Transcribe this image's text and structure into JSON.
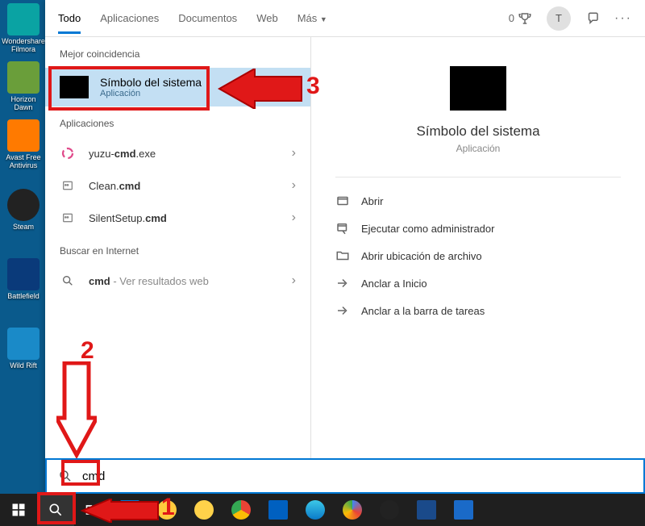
{
  "desktop": {
    "icons": [
      {
        "label": "Wondershare Filmora"
      },
      {
        "label": "Horizon Dawn"
      },
      {
        "label": "Avast Free Antivirus"
      },
      {
        "label": "Steam"
      },
      {
        "label": "Battlefield"
      },
      {
        "label": "Wild Rift"
      }
    ]
  },
  "header": {
    "tabs": [
      {
        "label": "Todo",
        "active": true
      },
      {
        "label": "Aplicaciones"
      },
      {
        "label": "Documentos"
      },
      {
        "label": "Web"
      },
      {
        "label": "Más"
      }
    ],
    "rewards": "0",
    "avatar": "T"
  },
  "left": {
    "best_label": "Mejor coincidencia",
    "best": {
      "title": "Símbolo del sistema",
      "sub": "Aplicación"
    },
    "apps_label": "Aplicaciones",
    "apps": [
      {
        "pre": "yuzu-",
        "bold": "cmd",
        "post": ".exe"
      },
      {
        "pre": "Clean.",
        "bold": "cmd",
        "post": ""
      },
      {
        "pre": "SilentSetup.",
        "bold": "cmd",
        "post": ""
      }
    ],
    "web_label": "Buscar en Internet",
    "web": {
      "bold": "cmd",
      "hint": " - Ver resultados web"
    }
  },
  "right": {
    "title": "Símbolo del sistema",
    "sub": "Aplicación",
    "actions": [
      {
        "icon": "open",
        "label": "Abrir"
      },
      {
        "icon": "admin",
        "label": "Ejecutar como administrador"
      },
      {
        "icon": "folder",
        "label": "Abrir ubicación de archivo"
      },
      {
        "icon": "pin-start",
        "label": "Anclar a Inicio"
      },
      {
        "icon": "pin-task",
        "label": "Anclar a la barra de tareas"
      }
    ]
  },
  "search": {
    "value": "cmd"
  },
  "annotations": {
    "n1": "1",
    "n2": "2",
    "n3": "3"
  }
}
